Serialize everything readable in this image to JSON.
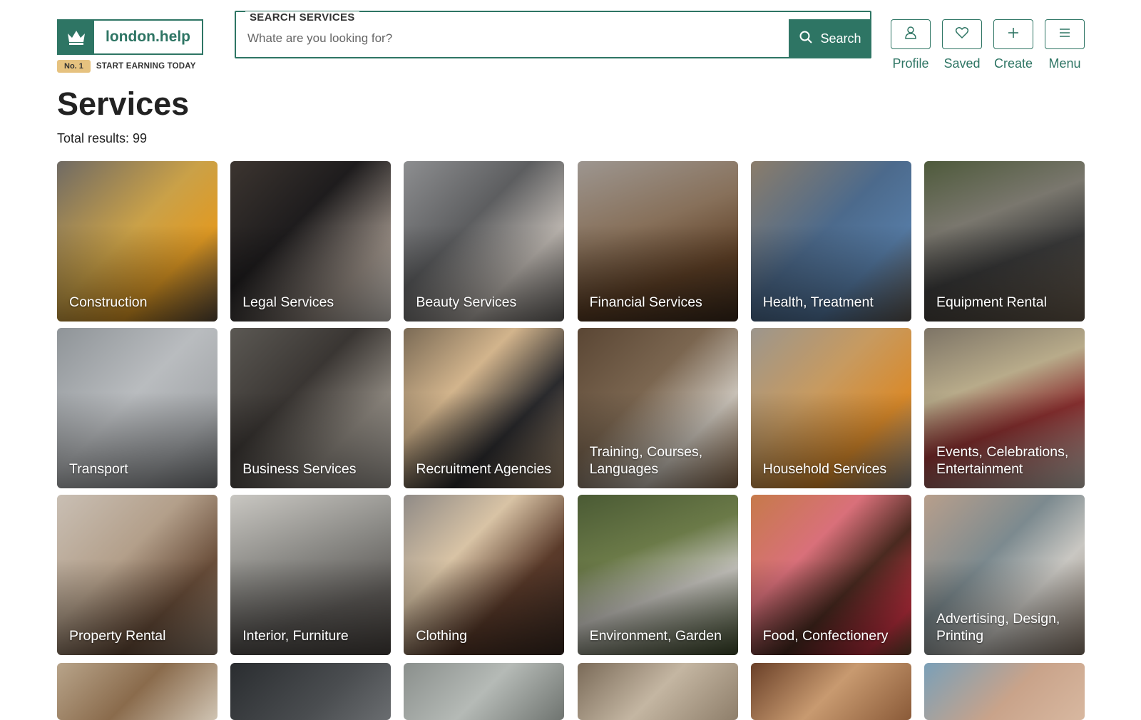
{
  "brand": {
    "name": "london.help",
    "badge": "No. 1",
    "tagline": "START EARNING TODAY",
    "color": "#2e7564"
  },
  "search": {
    "label": "SEARCH SERVICES",
    "placeholder": "Whate are you looking for?",
    "value": "",
    "button_label": "Search"
  },
  "actions": [
    {
      "label": "Profile",
      "icon": "user-icon"
    },
    {
      "label": "Saved",
      "icon": "heart-icon"
    },
    {
      "label": "Create",
      "icon": "plus-icon"
    },
    {
      "label": "Menu",
      "icon": "hamburger-icon"
    }
  ],
  "page": {
    "title": "Services",
    "total_results": "Total results: 99"
  },
  "categories": [
    {
      "label": "Construction",
      "image": "worker with hard hat and tool belt"
    },
    {
      "label": "Legal Services",
      "image": "signing documents"
    },
    {
      "label": "Beauty Services",
      "image": "beauty treatment"
    },
    {
      "label": "Financial Services",
      "image": "stacks of coins"
    },
    {
      "label": "Health, Treatment",
      "image": "doctor with patient"
    },
    {
      "label": "Equipment Rental",
      "image": "rental machinery"
    },
    {
      "label": "Transport",
      "image": "white van"
    },
    {
      "label": "Business Services",
      "image": "man on phone call"
    },
    {
      "label": "Recruitment Agencies",
      "image": "handshake interview"
    },
    {
      "label": "Training, Courses, Languages",
      "image": "student reading in library"
    },
    {
      "label": "Household Services",
      "image": "cleaning supplies"
    },
    {
      "label": "Events, Celebrations, Entertainment",
      "image": "glasses of wine and champagne"
    },
    {
      "label": "Property Rental",
      "image": "handing over keys"
    },
    {
      "label": "Interior, Furniture",
      "image": "dining room interior"
    },
    {
      "label": "Clothing",
      "image": "gloves, scarf and coffee"
    },
    {
      "label": "Environment, Garden",
      "image": "watering can in garden"
    },
    {
      "label": "Food, Confectionery",
      "image": "pastries and desserts"
    },
    {
      "label": "Advertising, Design, Printing",
      "image": "designers with prints"
    },
    {
      "label": "",
      "image": "pet care"
    },
    {
      "label": "",
      "image": "dark interior"
    },
    {
      "label": "",
      "image": "window frames"
    },
    {
      "label": "",
      "image": "crafts"
    },
    {
      "label": "",
      "image": "coffee"
    },
    {
      "label": "",
      "image": "puzzle pieces"
    }
  ]
}
